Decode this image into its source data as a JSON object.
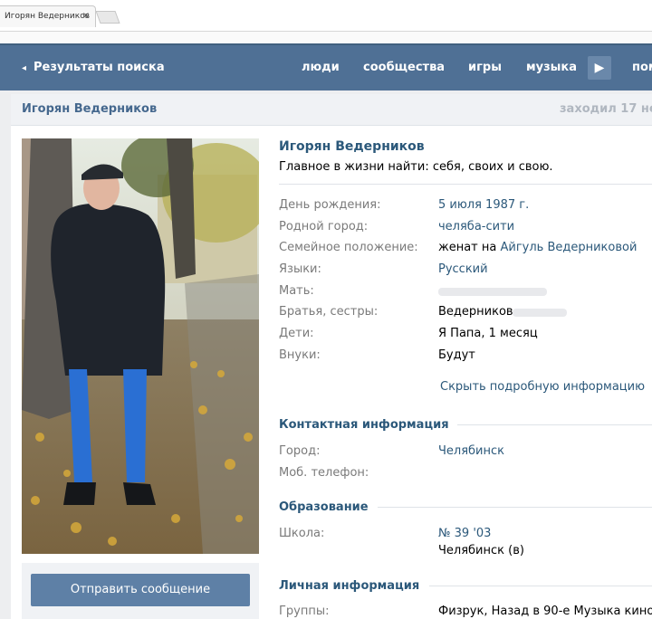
{
  "browser": {
    "tab_title": "Игорян Ведерников",
    "tab_close": "×"
  },
  "header": {
    "back_arrow": "◂",
    "back_label": "Результаты поиска",
    "nav": [
      "люди",
      "сообщества",
      "игры",
      "музыка"
    ],
    "nav_more_arrow": "▶",
    "nav_partial": "пом",
    "bg_color": "#4f7095"
  },
  "profile": {
    "name_bar": "Игорян Ведерников",
    "last_seen": "заходил 17 не",
    "name": "Игорян Ведерников",
    "status": "Главное в жизни найти: себя, своих и свою.",
    "info": [
      {
        "label": "День рождения:",
        "value": "5 июля 1987 г.",
        "link": true
      },
      {
        "label": "Родной город:",
        "value": "челяба-сити",
        "link": true
      },
      {
        "label": "Семейное положение:",
        "value_prefix": "женат на ",
        "value": "Айгуль Ведерниковой",
        "link": true
      },
      {
        "label": "Языки:",
        "value": "Русский",
        "link": true
      },
      {
        "label": "Мать:",
        "value": "",
        "link": false
      },
      {
        "label": "Братья, сестры:",
        "value": "Ведерников",
        "link": false
      },
      {
        "label": "Дети:",
        "value": "Я Папа, 1 месяц",
        "link": false
      },
      {
        "label": "Внуки:",
        "value": "Будут",
        "link": false
      }
    ],
    "hide_details": "Скрыть подробную информацию",
    "contacts_title": "Контактная информация",
    "contacts": [
      {
        "label": "Город:",
        "value": "Челябинск",
        "link": true
      },
      {
        "label": "Моб. телефон:",
        "value": "",
        "link": false
      }
    ],
    "education_title": "Образование",
    "school_label": "Школа:",
    "school_value": "№ 39 '03",
    "school_city": "Челябинск (в)",
    "personal_title": "Личная информация",
    "groups_label": "Группы:",
    "groups_value": "Физрук, Назад в 90-е Музыка кино",
    "send_message": "Отправить сообщение"
  }
}
